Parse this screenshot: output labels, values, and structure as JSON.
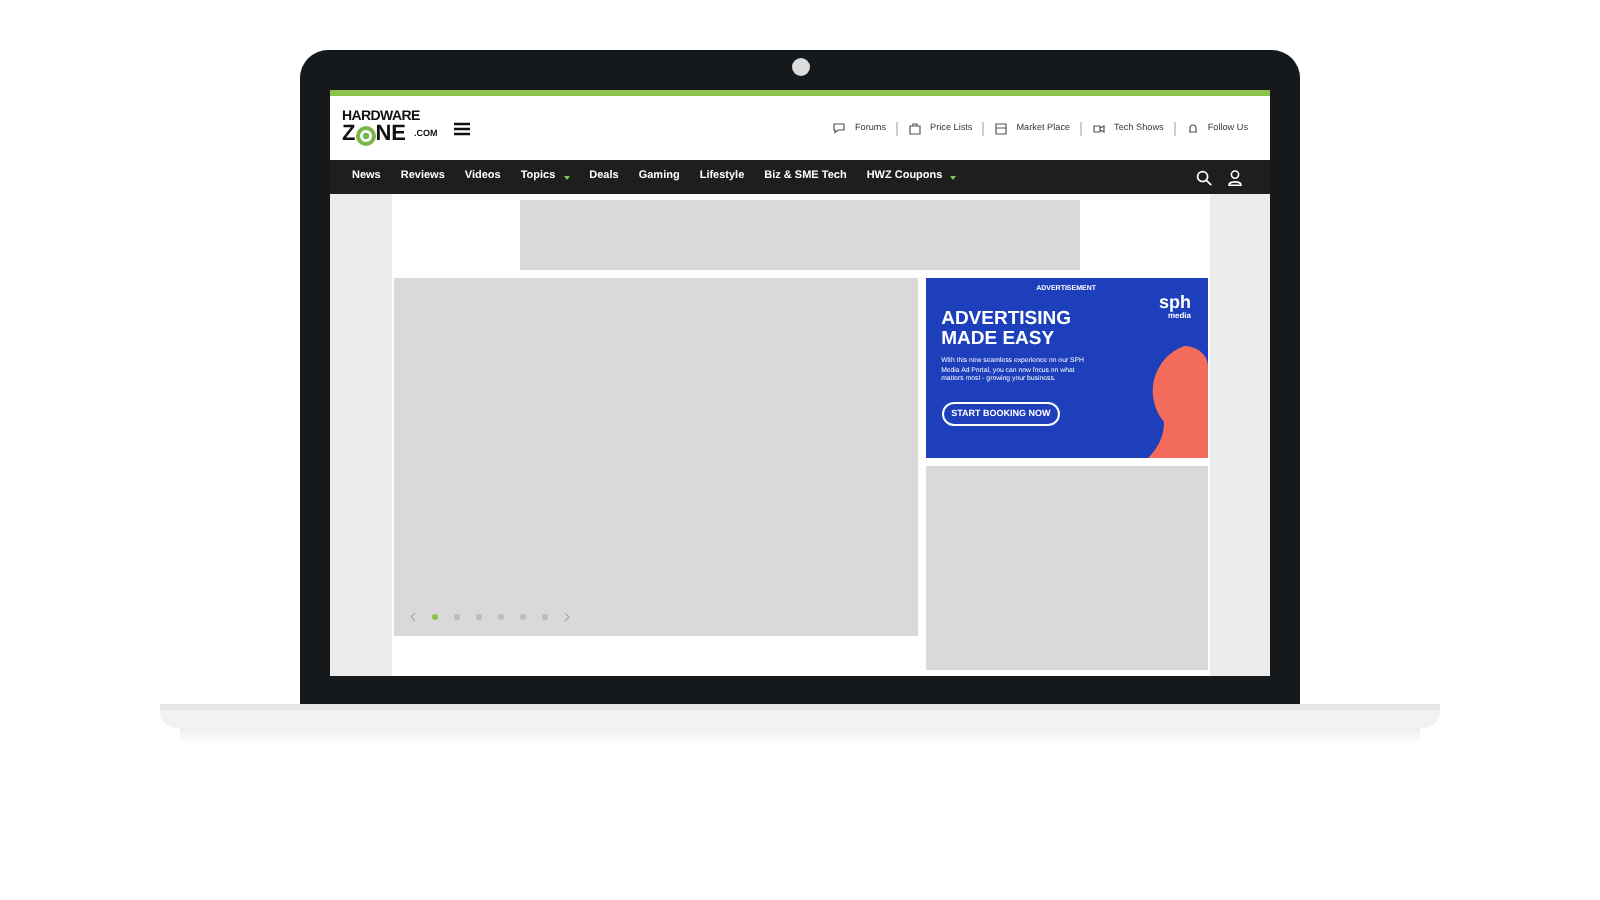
{
  "logo": {
    "top": "HARDWARE",
    "bottom_left": "Z",
    "bottom_right": "NE",
    "domain": ".COM"
  },
  "top_links": [
    {
      "label": "Forums",
      "kind": "chat"
    },
    {
      "label": "Price Lists",
      "kind": "bag"
    },
    {
      "label": "Market Place",
      "kind": "store"
    },
    {
      "label": "Tech Shows",
      "kind": "shows"
    },
    {
      "label": "Follow Us",
      "kind": "bell"
    }
  ],
  "nav": [
    {
      "label": "News",
      "dropdown": false
    },
    {
      "label": "Reviews",
      "dropdown": false
    },
    {
      "label": "Videos",
      "dropdown": false
    },
    {
      "label": "Topics",
      "dropdown": true
    },
    {
      "label": "Deals",
      "dropdown": false
    },
    {
      "label": "Gaming",
      "dropdown": false
    },
    {
      "label": "Lifestyle",
      "dropdown": false
    },
    {
      "label": "Biz & SME Tech",
      "dropdown": false
    },
    {
      "label": "HWZ Coupons",
      "dropdown": true
    }
  ],
  "slider": {
    "dots": [
      {
        "selected": true
      },
      {
        "selected": false
      },
      {
        "selected": false
      },
      {
        "selected": false
      },
      {
        "selected": false
      },
      {
        "selected": false
      }
    ]
  },
  "ad": {
    "label": "ADVERTISEMENT",
    "brand": "sph",
    "brand_sub": "media",
    "headline": [
      "ADVERTISING",
      "MADE EASY"
    ],
    "body": "With this new seamless experience on our SPH Media Ad Portal, you can now focus on what matters most - growing your business.",
    "button": "START BOOKING NOW"
  }
}
